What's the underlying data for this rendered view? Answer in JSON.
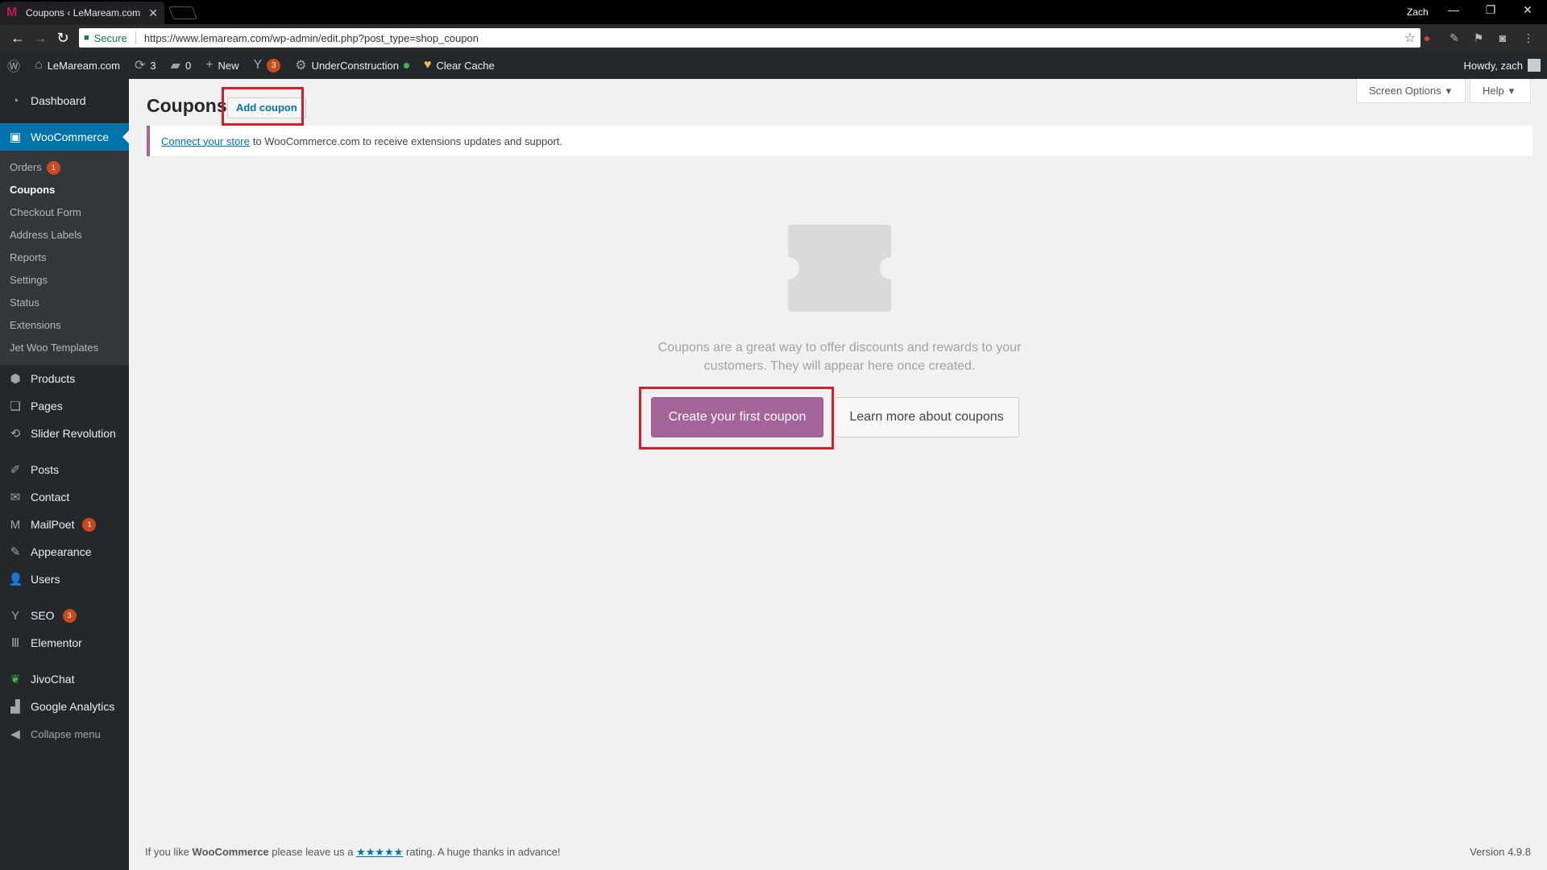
{
  "browser": {
    "tab_title": "Coupons ‹ LeMaream.com",
    "profile": "Zach",
    "secure_label": "Secure",
    "url": "https://www.lemaream.com/wp-admin/edit.php?post_type=shop_coupon"
  },
  "admin_bar": {
    "site_name": "LeMaream.com",
    "updates_count": "3",
    "comments_count": "0",
    "new_label": "New",
    "yoast_badge": "3",
    "under_construction": "UnderConstruction",
    "clear_cache": "Clear Cache",
    "howdy": "Howdy, zach"
  },
  "sidebar": {
    "dashboard": "Dashboard",
    "woocommerce": "WooCommerce",
    "sub": {
      "orders": "Orders",
      "orders_badge": "1",
      "coupons": "Coupons",
      "checkout_form": "Checkout Form",
      "address_labels": "Address Labels",
      "reports": "Reports",
      "settings": "Settings",
      "status": "Status",
      "extensions": "Extensions",
      "jet_woo": "Jet Woo Templates"
    },
    "products": "Products",
    "pages": "Pages",
    "slider_revolution": "Slider Revolution",
    "posts": "Posts",
    "contact": "Contact",
    "mailpoet": "MailPoet",
    "mailpoet_badge": "1",
    "appearance": "Appearance",
    "users": "Users",
    "seo": "SEO",
    "seo_badge": "3",
    "elementor": "Elementor",
    "jivochat": "JivoChat",
    "google_analytics": "Google Analytics",
    "collapse": "Collapse menu"
  },
  "main": {
    "screen_options": "Screen Options",
    "help": "Help",
    "title": "Coupons",
    "add_coupon": "Add coupon",
    "notice_link": "Connect your store",
    "notice_text": "to WooCommerce.com to receive extensions updates and support.",
    "empty_message": "Coupons are a great way to offer discounts and rewards to your customers. They will appear here once created.",
    "create_first": "Create your first coupon",
    "learn_more": "Learn more about coupons"
  },
  "footer": {
    "prefix": "If you like",
    "brand": "WooCommerce",
    "middle": "please leave us a",
    "stars": "★★★★★",
    "suffix": "rating. A huge thanks in advance!",
    "version": "Version 4.9.8"
  },
  "colors": {
    "woo_purple": "#a46497",
    "wp_blue": "#0073aa",
    "highlight_red": "#d0202e",
    "admin_dark": "#23282d"
  }
}
